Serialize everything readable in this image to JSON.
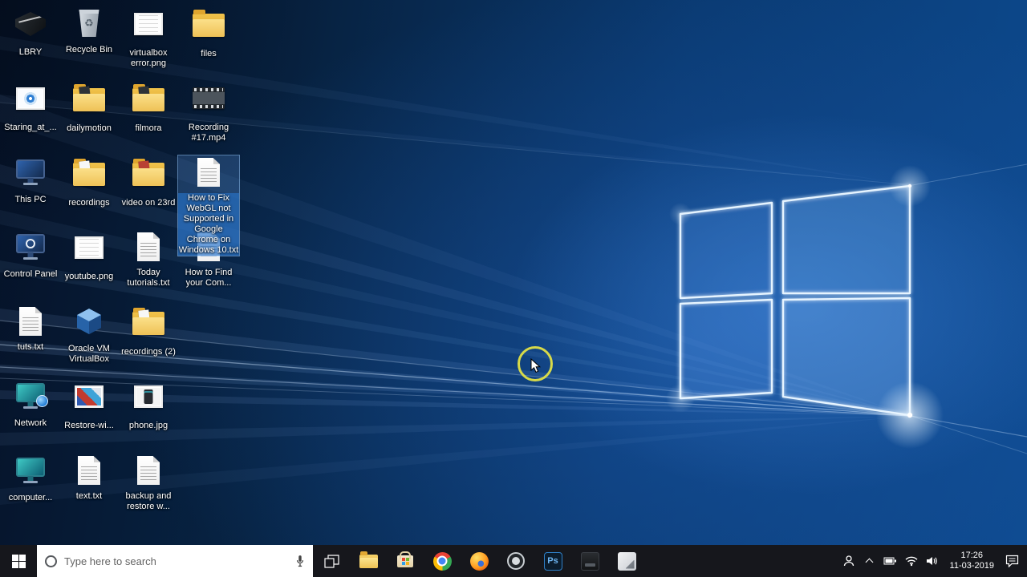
{
  "colors": {
    "taskbar_bg": "#16171c",
    "selection_highlight": "#2d7ddb",
    "wallpaper_base": "#0a3a72",
    "accent": "#0078d7",
    "click_ring": "#e1e146"
  },
  "desktop": {
    "icons": {
      "lbry": {
        "label": "LBRY"
      },
      "staring": {
        "label": "Staring_at_..."
      },
      "this_pc": {
        "label": "This PC"
      },
      "control_panel": {
        "label": "Control Panel"
      },
      "tuts": {
        "label": "tuts.txt"
      },
      "network": {
        "label": "Network"
      },
      "computer": {
        "label": "computer..."
      },
      "recycle_bin": {
        "label": "Recycle Bin"
      },
      "dailymotion": {
        "label": "dailymotion"
      },
      "recordings": {
        "label": "recordings"
      },
      "youtube": {
        "label": "youtube.png"
      },
      "oracle_vbox": {
        "label": "Oracle VM VirtualBox"
      },
      "restore_wi": {
        "label": "Restore-wi..."
      },
      "text_txt": {
        "label": "text.txt"
      },
      "virtualbox_error": {
        "label": "virtualbox error.png"
      },
      "filmora": {
        "label": "filmora"
      },
      "video_23rd": {
        "label": "video on 23rd"
      },
      "today_tutorials": {
        "label": "Today tutorials.txt"
      },
      "recordings_2": {
        "label": "recordings (2)"
      },
      "phone": {
        "label": "phone.jpg"
      },
      "backup": {
        "label": "backup and restore w..."
      },
      "files": {
        "label": "files"
      },
      "recording_17": {
        "label": "Recording #17.mp4"
      },
      "webgl": {
        "label": "How to Fix WebGL not Supported in Google Chrome on Windows 10.txt",
        "selected": true
      },
      "how_to_find": {
        "label": "How to Find your Com..."
      }
    }
  },
  "taskbar": {
    "search_placeholder": "Type here to search",
    "ps_label": "Ps",
    "apps": [
      "task-view",
      "file-explorer",
      "microsoft-store",
      "chrome",
      "firefox",
      "screen-recorder",
      "photoshop",
      "dark-app",
      "media-app"
    ],
    "tray_icons": [
      "people",
      "hidden-icons-chevron",
      "battery",
      "network",
      "volume",
      "action-center"
    ],
    "clock": {
      "time": "17:26",
      "date": "11-03-2019"
    }
  }
}
